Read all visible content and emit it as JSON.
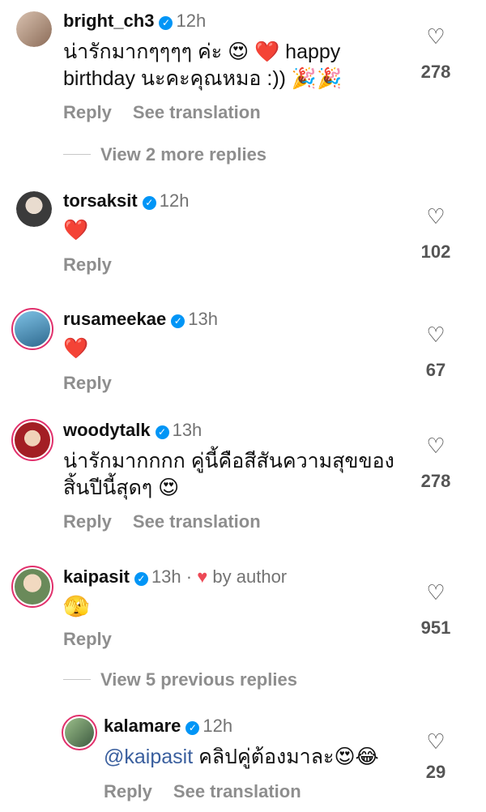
{
  "comments": [
    {
      "username": "bright_ch3",
      "time": "12h",
      "text": "น่ารักมากๆๆๆๆ ค่ะ 😍 ❤️ happy birthday นะคะคุณหมอ :)) 🎉🎉",
      "reply_label": "Reply",
      "translate_label": "See translation",
      "likes": "278",
      "more_replies": "View 2 more replies"
    },
    {
      "username": "torsaksit",
      "time": "12h",
      "text": "❤️",
      "reply_label": "Reply",
      "likes": "102"
    },
    {
      "username": "rusameekae",
      "time": "13h",
      "text": "❤️",
      "reply_label": "Reply",
      "likes": "67"
    },
    {
      "username": "woodytalk",
      "time": "13h",
      "text": "น่ารักมากกกก คู่นี้คือสีสันความสุขของสิ้นปีนี้สุดๆ 😍",
      "reply_label": "Reply",
      "translate_label": "See translation",
      "likes": "278"
    },
    {
      "username": "kaipasit",
      "time": "13h",
      "author_badge": "by author",
      "text": "🫣",
      "reply_label": "Reply",
      "likes": "951",
      "more_replies": "View 5 previous replies"
    }
  ],
  "reply": {
    "username": "kalamare",
    "time": "12h",
    "mention": "@kaipasit",
    "text": "คลิปคู่ต้องมาละ😍😂",
    "reply_label": "Reply",
    "translate_label": "See translation",
    "likes": "29"
  },
  "colors": {
    "verified": "#0095f6",
    "secondary_text": "#8e8e8e",
    "ring": "#e1306c"
  },
  "icons": {
    "like": "heart-outline-icon",
    "verified": "verified-badge-icon"
  }
}
